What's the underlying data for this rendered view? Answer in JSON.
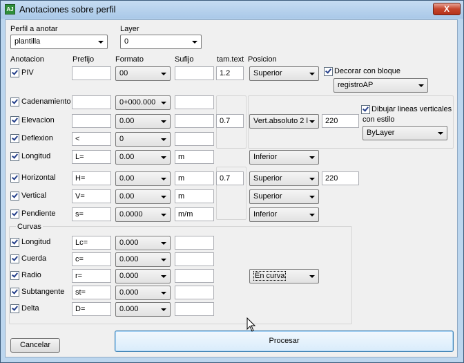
{
  "window": {
    "title": "Anotaciones sobre perfil",
    "close_label": "X",
    "icon_text": "AJ"
  },
  "perfil": {
    "label": "Perfil a anotar",
    "value": "plantilla"
  },
  "layer": {
    "label": "Layer",
    "value": "0"
  },
  "headers": {
    "anotacion": "Anotacion",
    "prefijo": "Prefijo",
    "formato": "Formato",
    "sufijo": "Sufijo",
    "tamtext": "tam.text",
    "posicion": "Posicion"
  },
  "rows": {
    "piv": {
      "label": "PIV",
      "prefijo": "",
      "formato": "00",
      "sufijo": "",
      "tam": "1.2",
      "posicion": "Superior"
    },
    "cadenamiento": {
      "label": "Cadenamiento",
      "prefijo": "",
      "formato": "0+000.000",
      "sufijo": ""
    },
    "elevacion": {
      "label": "Elevacion",
      "prefijo": "",
      "formato": "0.00",
      "sufijo": ""
    },
    "deflexion": {
      "label": "Deflexion",
      "prefijo": "<",
      "formato": "0",
      "sufijo": ""
    },
    "longitud": {
      "label": "Longitud",
      "prefijo": "L=",
      "formato": "0.00",
      "sufijo": "m"
    },
    "horizontal": {
      "label": "Horizontal",
      "prefijo": "H=",
      "formato": "0.00",
      "sufijo": "m"
    },
    "vertical": {
      "label": "Vertical",
      "prefijo": "V=",
      "formato": "0.00",
      "sufijo": "m"
    },
    "pendiente": {
      "label": "Pendiente",
      "prefijo": "s=",
      "formato": "0.0000",
      "sufijo": "m/m"
    }
  },
  "group1": {
    "tam": "0.7",
    "posicion": "Vert.absoluto 2 l",
    "value": "220"
  },
  "decorar": {
    "label": "Decorar con bloque",
    "bloque": "registroAP"
  },
  "dibujar": {
    "label_line1": "Dibujar lineas verticales",
    "label_line2": "con estilo",
    "estilo": "ByLayer"
  },
  "longitud_pos": "Inferior",
  "group2": {
    "tam": "0.7",
    "horizontal_pos": "Superior",
    "horizontal_value": "220",
    "vertical_pos": "Superior",
    "pendiente_pos": "Inferior"
  },
  "curvas": {
    "title": "Curvas",
    "longitud": {
      "label": "Longitud",
      "prefijo": "Lc=",
      "formato": "0.000",
      "sufijo": ""
    },
    "cuerda": {
      "label": "Cuerda",
      "prefijo": "c=",
      "formato": "0.000",
      "sufijo": ""
    },
    "radio": {
      "label": "Radio",
      "prefijo": "r=",
      "formato": "0.000",
      "sufijo": ""
    },
    "subtangente": {
      "label": "Subtangente",
      "prefijo": "st=",
      "formato": "0.000",
      "sufijo": ""
    },
    "delta": {
      "label": "Delta",
      "prefijo": "D=",
      "formato": "0.000",
      "sufijo": ""
    },
    "posicion": "En curva"
  },
  "buttons": {
    "cancelar": "Cancelar",
    "procesar": "Procesar"
  }
}
